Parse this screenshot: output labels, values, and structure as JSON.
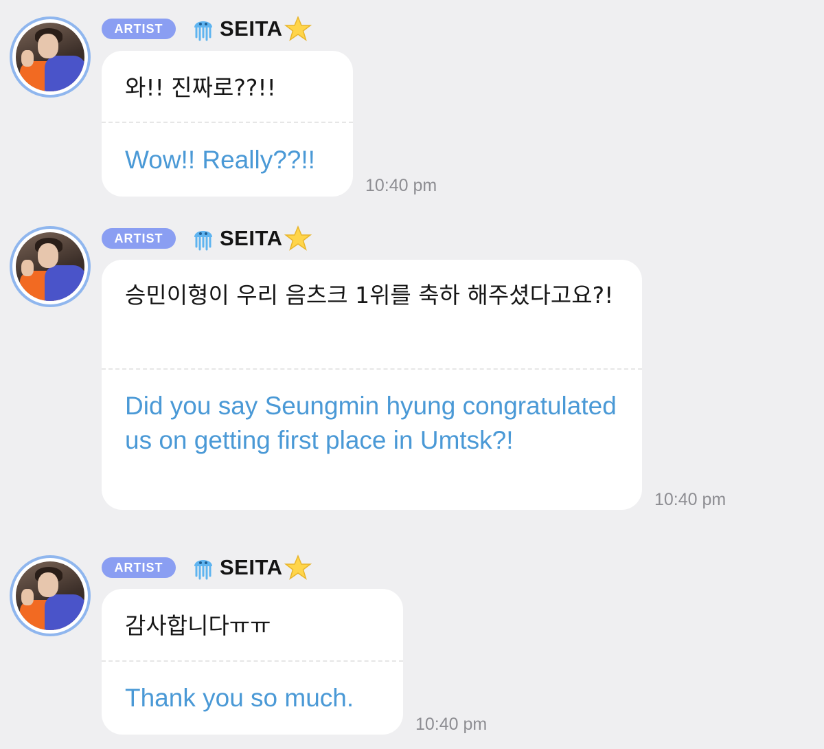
{
  "chat": {
    "messages": [
      {
        "badge": "ARTIST",
        "icon": "jellyfish-icon",
        "sender": "SEITA",
        "sender_emoji": "star-icon",
        "korean": "와!! 진짜로??!!",
        "translation": "Wow!! Really??!!",
        "time": "10:40 pm"
      },
      {
        "badge": "ARTIST",
        "icon": "jellyfish-icon",
        "sender": "SEITA",
        "sender_emoji": "star-icon",
        "korean": "승민이형이 우리 음츠크 1위를 축하 해주셨다고요?!",
        "translation": "Did you say Seungmin hyung congratulated us on getting first place in Umtsk?!",
        "time": "10:40 pm"
      },
      {
        "badge": "ARTIST",
        "icon": "jellyfish-icon",
        "sender": "SEITA",
        "sender_emoji": "star-icon",
        "korean": "감사합니다ㅠㅠ",
        "translation": "Thank you so much.",
        "time": "10:40 pm"
      }
    ]
  },
  "colors": {
    "background": "#efeff1",
    "badge": "#8a9ef2",
    "avatar_ring": "#8fb6ee",
    "translation_text": "#4a99d6",
    "timestamp": "#8d8d92"
  }
}
